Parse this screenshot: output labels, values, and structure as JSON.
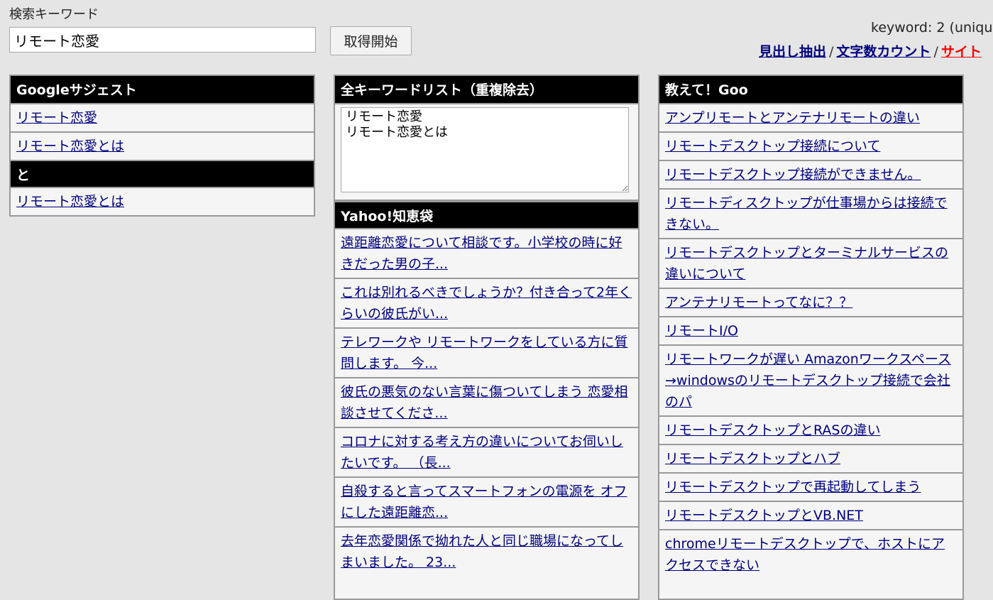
{
  "search": {
    "label": "検索キーワード",
    "value": "リモート恋愛",
    "button_label": "取得開始"
  },
  "topright": {
    "keyword_count": "keyword: 2 (uniqu",
    "links": [
      {
        "label": "見出し抽出"
      },
      {
        "label": "文字数カウント"
      },
      {
        "label": "サイト"
      }
    ],
    "separator": "/"
  },
  "google": {
    "header": "Googleサジェスト",
    "items": [
      "リモート恋愛",
      "リモート恋愛とは"
    ],
    "sub_header": "と",
    "sub_items": [
      "リモート恋愛とは"
    ]
  },
  "keywords": {
    "header": "全キーワードリスト（重複除去）",
    "textarea_value": "リモート恋愛\nリモート恋愛とは"
  },
  "yahoo": {
    "header": "Yahoo!知恵袋",
    "items": [
      "遠距離恋愛について相談です。小学校の時に好きだった男の子...",
      "これは別れるべきでしょうか？付き合って2年くらいの彼氏がい...",
      "テレワークや リモートワークをしている方に質問します。 今...",
      "彼氏の悪気のない言葉に傷ついてしまう 恋愛相談させてくださ...",
      "コロナに対する考え方の違いについてお伺いしたいです。 （長...",
      "自殺すると言ってスマートフォンの電源を オフにした遠距離恋...",
      "去年恋愛関係で拗れた人と同じ職場になってしまいました。 23..."
    ]
  },
  "goo": {
    "header": "教えて！Goo",
    "items": [
      "アンプリモートとアンテナリモートの違い",
      "リモートデスクトップ接続について",
      "リモートデスクトップ接続ができません。",
      "リモートディスクトップが仕事場からは接続できない。",
      "リモートデスクトップとターミナルサービスの違いについて",
      "アンテナリモートってなに？？",
      "リモートI/O",
      "リモートワークが遅い Amazonワークスペース→windowsのリモートデスクトップ接続で会社のパ",
      "リモートデスクトップとRASの違い",
      "リモートデスクトップとハブ",
      "リモートデスクトップで再起動してしまう",
      "リモートデスクトップとVB.NET",
      "chromeリモートデスクトップで、ホストにアクセスできない"
    ]
  }
}
